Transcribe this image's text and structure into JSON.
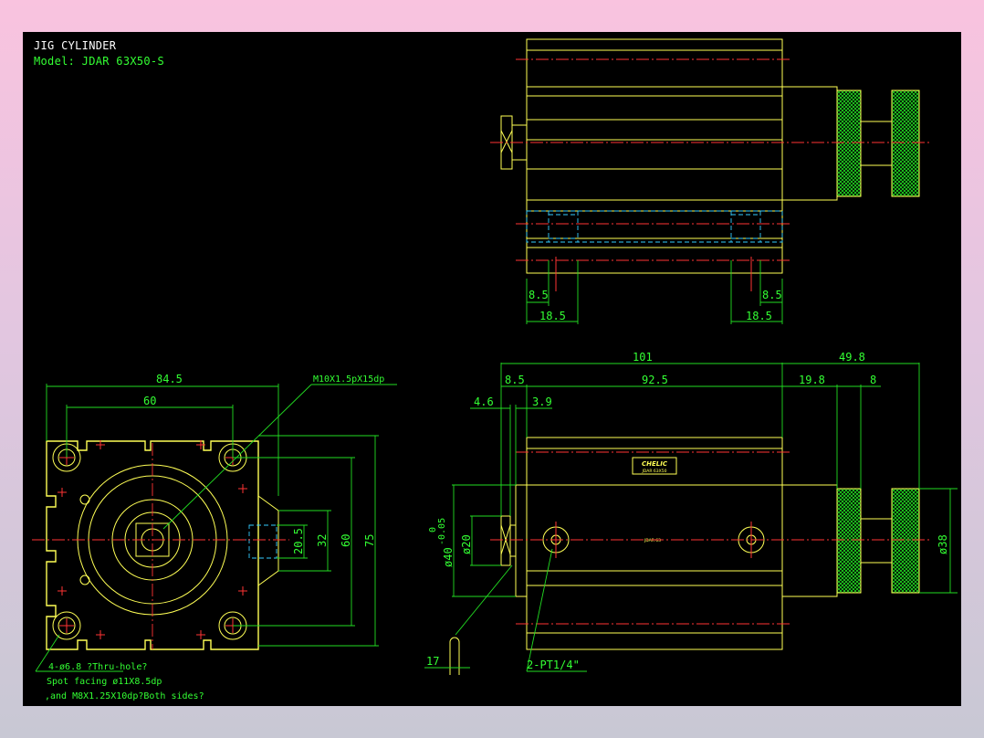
{
  "drawing": {
    "title": "JIG CYLINDER",
    "model": "Model: JDAR 63X50-S",
    "brand": "CHELIC",
    "brand_sub": "JDAR 63X50",
    "center_mark": "JDAR 63",
    "colors": {
      "sheet": "#000000",
      "outline": "#ffff55",
      "dimension": "#22dd22",
      "centerline": "#ff3333",
      "hidden": "#33ccff"
    }
  },
  "dimensions": {
    "top_left_small": "8.5",
    "top_left_large": "18.5",
    "top_right_small": "8.5",
    "top_right_large": "18.5",
    "length_overall": "101",
    "rod_extension": "49.8",
    "cap": "8.5",
    "body": "92.5",
    "knurl_gap": "19.8",
    "knurl_width": "8",
    "flange_a": "4.6",
    "flange_b": "3.9",
    "front_width": "84.5",
    "front_pitch": "60",
    "v_20_5": "20.5",
    "v_32": "32",
    "v_60": "60",
    "v_75": "75",
    "bore_tol_upper": "0",
    "bore_tol_lower": "-0.05",
    "bore": "ø40",
    "rod": "ø20",
    "knurl_dia": "ø38",
    "groove": "17"
  },
  "notes": {
    "thread": "M10X1.5pX15dp",
    "port": "2-PT1/4\"",
    "holes_1": "4-ø6.8 ?Thru-hole?",
    "holes_2": "Spot facing ø11X8.5dp",
    "holes_3": ",and M8X1.25X10dp?Both sides?"
  }
}
